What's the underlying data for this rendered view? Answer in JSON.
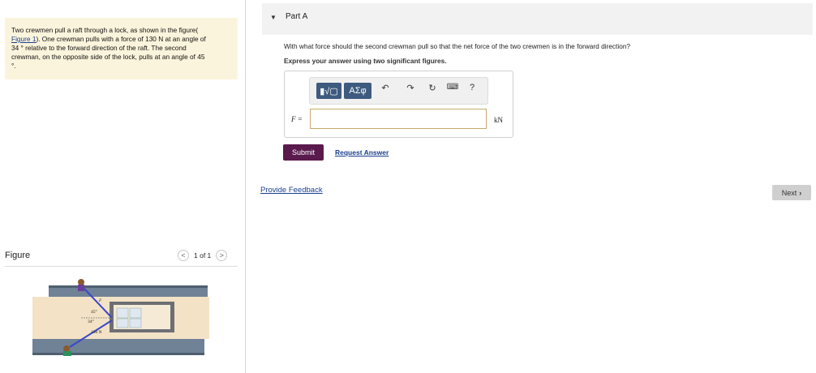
{
  "problem": {
    "text_line1": "Two crewmen pull a raft through a lock, as shown in the figure(",
    "link": "Figure 1",
    "text_line2_rest": "). One crewman pulls with a force of 130 N at an angle of",
    "text_line3": "34 ° relative to the forward direction of the raft. The second",
    "text_line4": "crewman, on the opposite side of the lock, pulls at an angle of 45",
    "text_line5": "°."
  },
  "figure_panel": {
    "label": "Figure",
    "pager": "1 of 1",
    "prev_icon": "chevron-left-icon",
    "next_icon": "chevron-right-icon",
    "labels": {
      "angle_top": "45°",
      "angle_bottom": "34°",
      "force": "130 N",
      "f_label": "F"
    }
  },
  "part": {
    "title": "Part A",
    "collapse_icon": "triangle-down-icon"
  },
  "question": "With what force should the second crewman pull so that the net force of the two crewmen is in the forward direction?",
  "instruction": "Express your answer using two significant figures.",
  "toolbar": {
    "templates": "▮√▢",
    "greek": "ΑΣφ",
    "undo_icon": "undo-icon",
    "redo_icon": "redo-icon",
    "reset_icon": "reset-icon",
    "keyboard_icon": "keyboard-icon",
    "help": "?"
  },
  "answer": {
    "label": "F =",
    "value": "",
    "unit": "kN"
  },
  "submit_label": "Submit",
  "request_answer": "Request Answer",
  "feedback": "Provide Feedback",
  "next_label": "Next",
  "colors": {
    "submit_bg": "#5b1a4d",
    "link": "#1a3f8f",
    "problem_bg": "#fbf4dc",
    "toolbar_btn": "#3e5b7f"
  }
}
